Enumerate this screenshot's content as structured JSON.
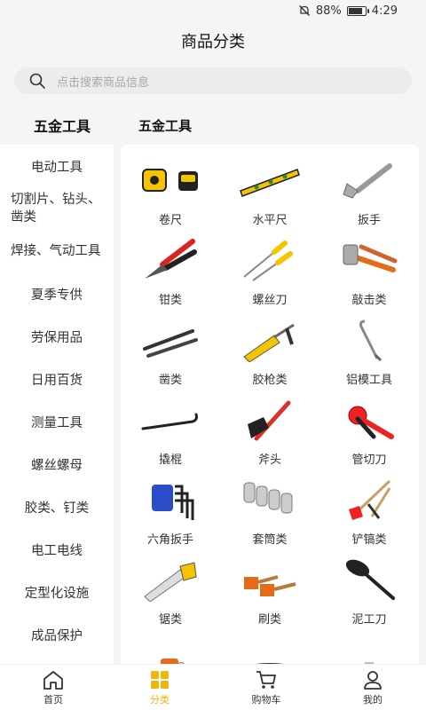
{
  "status": {
    "battery": "88%",
    "battery_level": 0.88,
    "time": "4:29"
  },
  "header": {
    "title": "商品分类"
  },
  "search": {
    "placeholder": "点击搜索商品信息"
  },
  "category": {
    "left_title": "五金工具",
    "right_title": "五金工具"
  },
  "sidebar": {
    "items": [
      {
        "label": "电动工具"
      },
      {
        "label": "切割片、钻头、凿类"
      },
      {
        "label": "焊接、气动工具"
      },
      {
        "label": "夏季专供"
      },
      {
        "label": "劳保用品"
      },
      {
        "label": "日用百货"
      },
      {
        "label": "测量工具"
      },
      {
        "label": "螺丝螺母"
      },
      {
        "label": "胶类、钉类"
      },
      {
        "label": "电工电线"
      },
      {
        "label": "定型化设施"
      },
      {
        "label": "成品保护"
      }
    ]
  },
  "products": [
    {
      "label": "卷尺",
      "icon": "tape-measure-icon"
    },
    {
      "label": "水平尺",
      "icon": "spirit-level-icon"
    },
    {
      "label": "扳手",
      "icon": "wrench-icon"
    },
    {
      "label": "钳类",
      "icon": "pliers-icon"
    },
    {
      "label": "螺丝刀",
      "icon": "screwdriver-icon"
    },
    {
      "label": "敲击类",
      "icon": "hammer-icon"
    },
    {
      "label": "凿类",
      "icon": "chisel-icon"
    },
    {
      "label": "胶枪类",
      "icon": "caulking-gun-icon"
    },
    {
      "label": "铝模工具",
      "icon": "hook-tool-icon"
    },
    {
      "label": "撬棍",
      "icon": "crowbar-icon"
    },
    {
      "label": "斧头",
      "icon": "axe-icon"
    },
    {
      "label": "管切刀",
      "icon": "pipe-cutter-icon"
    },
    {
      "label": "六角扳手",
      "icon": "hex-key-icon"
    },
    {
      "label": "套筒类",
      "icon": "socket-icon"
    },
    {
      "label": "铲镐类",
      "icon": "shovel-pick-icon"
    },
    {
      "label": "锯类",
      "icon": "saw-icon"
    },
    {
      "label": "刷类",
      "icon": "brush-icon"
    },
    {
      "label": "泥工刀",
      "icon": "trowel-icon"
    },
    {
      "label": "",
      "icon": "float-trowel-icon"
    },
    {
      "label": "",
      "icon": "bucket-icon"
    },
    {
      "label": "",
      "icon": "drill-bits-icon"
    }
  ],
  "tabbar": {
    "items": [
      {
        "label": "首页",
        "icon": "home-icon"
      },
      {
        "label": "分类",
        "icon": "category-icon",
        "active": true
      },
      {
        "label": "购物车",
        "icon": "cart-icon"
      },
      {
        "label": "我的",
        "icon": "user-icon"
      }
    ]
  },
  "colors": {
    "accent": "#f1b60c",
    "background": "#f5f5f5"
  }
}
